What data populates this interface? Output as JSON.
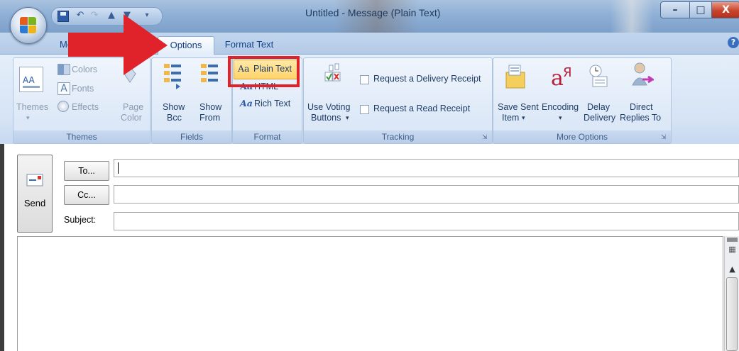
{
  "window": {
    "title": "Untitled - Message (Plain Text)",
    "buttons": {
      "minimize": "–",
      "maximize": "□",
      "close": "X"
    }
  },
  "quick_access": {
    "icons": [
      "save-icon",
      "undo-icon",
      "redo-icon",
      "up-arrow-icon",
      "down-arrow-icon",
      "customize-dropdown-icon"
    ]
  },
  "tabs": {
    "message": "Me",
    "options": "Options",
    "format_text": "Format Text"
  },
  "help_icon": "?",
  "ribbon": {
    "themes": {
      "label": "Themes",
      "themes_btn": "Themes",
      "colors": "Colors",
      "fonts": "Fonts",
      "effects": "Effects",
      "page_color_line1": "Page",
      "page_color_line2": "Color"
    },
    "fields": {
      "label": "Fields",
      "show_bcc_line1": "Show",
      "show_bcc_line2": "Bcc",
      "show_from_line1": "Show",
      "show_from_line2": "From"
    },
    "format": {
      "label": "Format",
      "plain_text": "Plain Text",
      "html": "HTML",
      "rich_text": "Rich Text",
      "glyph": "Aa"
    },
    "tracking": {
      "label": "Tracking",
      "voting_line1": "Use Voting",
      "voting_line2": "Buttons",
      "delivery_receipt": "Request a Delivery Receipt",
      "read_receipt": "Request a Read Receipt"
    },
    "more_options": {
      "label": "More Options",
      "save_sent_line1": "Save Sent",
      "save_sent_line2": "Item",
      "encoding": "Encoding",
      "delay_line1": "Delay",
      "delay_line2": "Delivery",
      "direct_line1": "Direct",
      "direct_line2": "Replies To"
    }
  },
  "compose": {
    "send": "Send",
    "to_btn": "To...",
    "cc_btn": "Cc...",
    "subject_label": "Subject:",
    "to_value": "",
    "cc_value": "",
    "subject_value": ""
  },
  "colors": {
    "highlight_red": "#e0232a",
    "ribbon_blue": "#d6e4f5",
    "accent_text": "#15428b"
  }
}
